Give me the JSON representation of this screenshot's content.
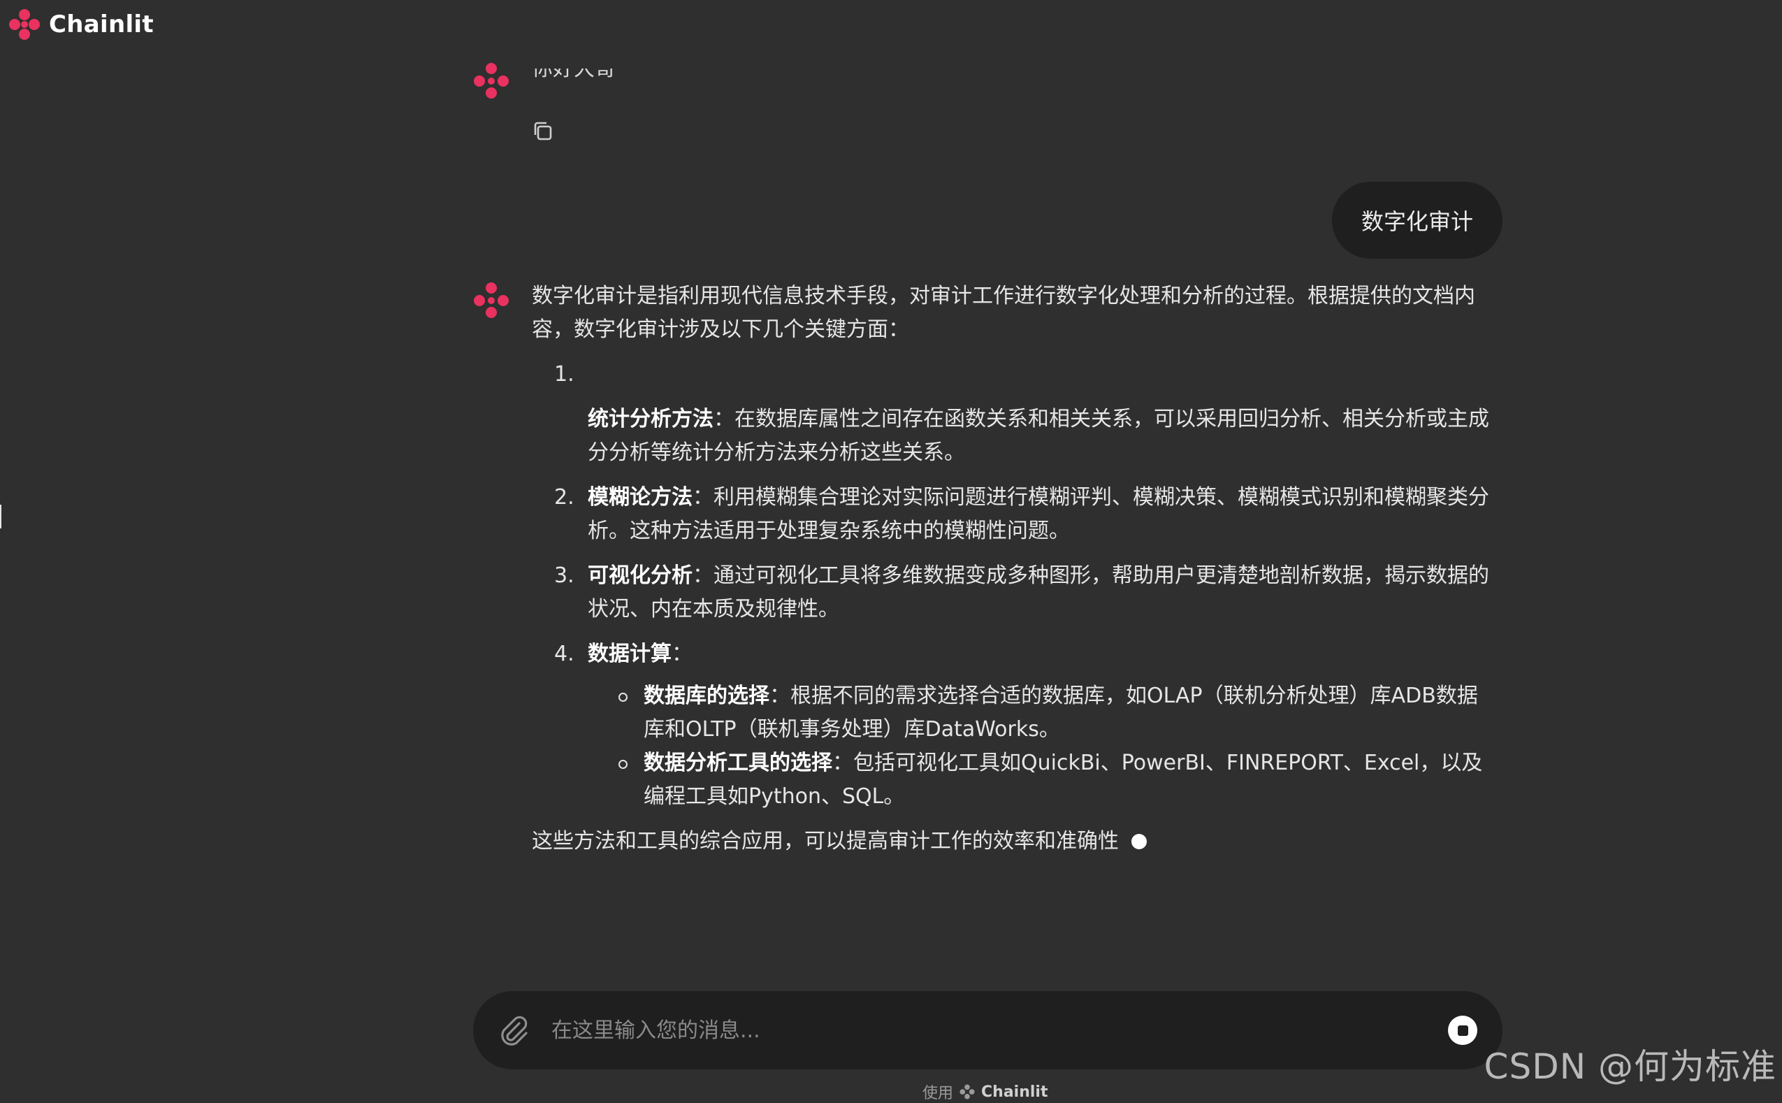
{
  "app": {
    "brand": "Chainlit",
    "accent": "#e9325f"
  },
  "greeting": {
    "text": "你好大哥",
    "copy_icon": "copy-icon"
  },
  "user_message": {
    "text": "数字化审计"
  },
  "answer": {
    "intro": "数字化审计是指利用现代信息技术手段，对审计工作进行数字化处理和分析的过程。根据提供的文档内容，数字化审计涉及以下几个关键方面：",
    "items": [
      {
        "num": "1.",
        "title": "统计分析方法",
        "text": "：在数据库属性之间存在函数关系和相关关系，可以采用回归分析、相关分析或主成分分析等统计分析方法来分析这些关系。"
      },
      {
        "num": "2.",
        "title": "模糊论方法",
        "text": "：利用模糊集合理论对实际问题进行模糊评判、模糊决策、模糊模式识别和模糊聚类分析。这种方法适用于处理复杂系统中的模糊性问题。"
      },
      {
        "num": "3.",
        "title": "可视化分析",
        "text": "：通过可视化工具将多维数据变成多种图形，帮助用户更清楚地剖析数据，揭示数据的状况、内在本质及规律性。"
      },
      {
        "num": "4.",
        "title": "数据计算",
        "text": "："
      }
    ],
    "subitems": [
      {
        "title": "数据库的选择",
        "text": "：根据不同的需求选择合适的数据库，如OLAP（联机分析处理）库ADB数据库和OLTP（联机事务处理）库DataWorks。"
      },
      {
        "title": "数据分析工具的选择",
        "text": "：包括可视化工具如QuickBi、PowerBI、FINREPORT、Excel，以及编程工具如Python、SQL。"
      }
    ],
    "closing": "这些方法和工具的综合应用，可以提高审计工作的效率和准确性"
  },
  "composer": {
    "placeholder": "在这里输入您的消息...",
    "value": "",
    "attach_icon": "paperclip-icon",
    "stop_icon": "stop-icon"
  },
  "footer": {
    "prefix": "使用",
    "brand": "Chainlit"
  },
  "watermark": "CSDN @何为标准"
}
